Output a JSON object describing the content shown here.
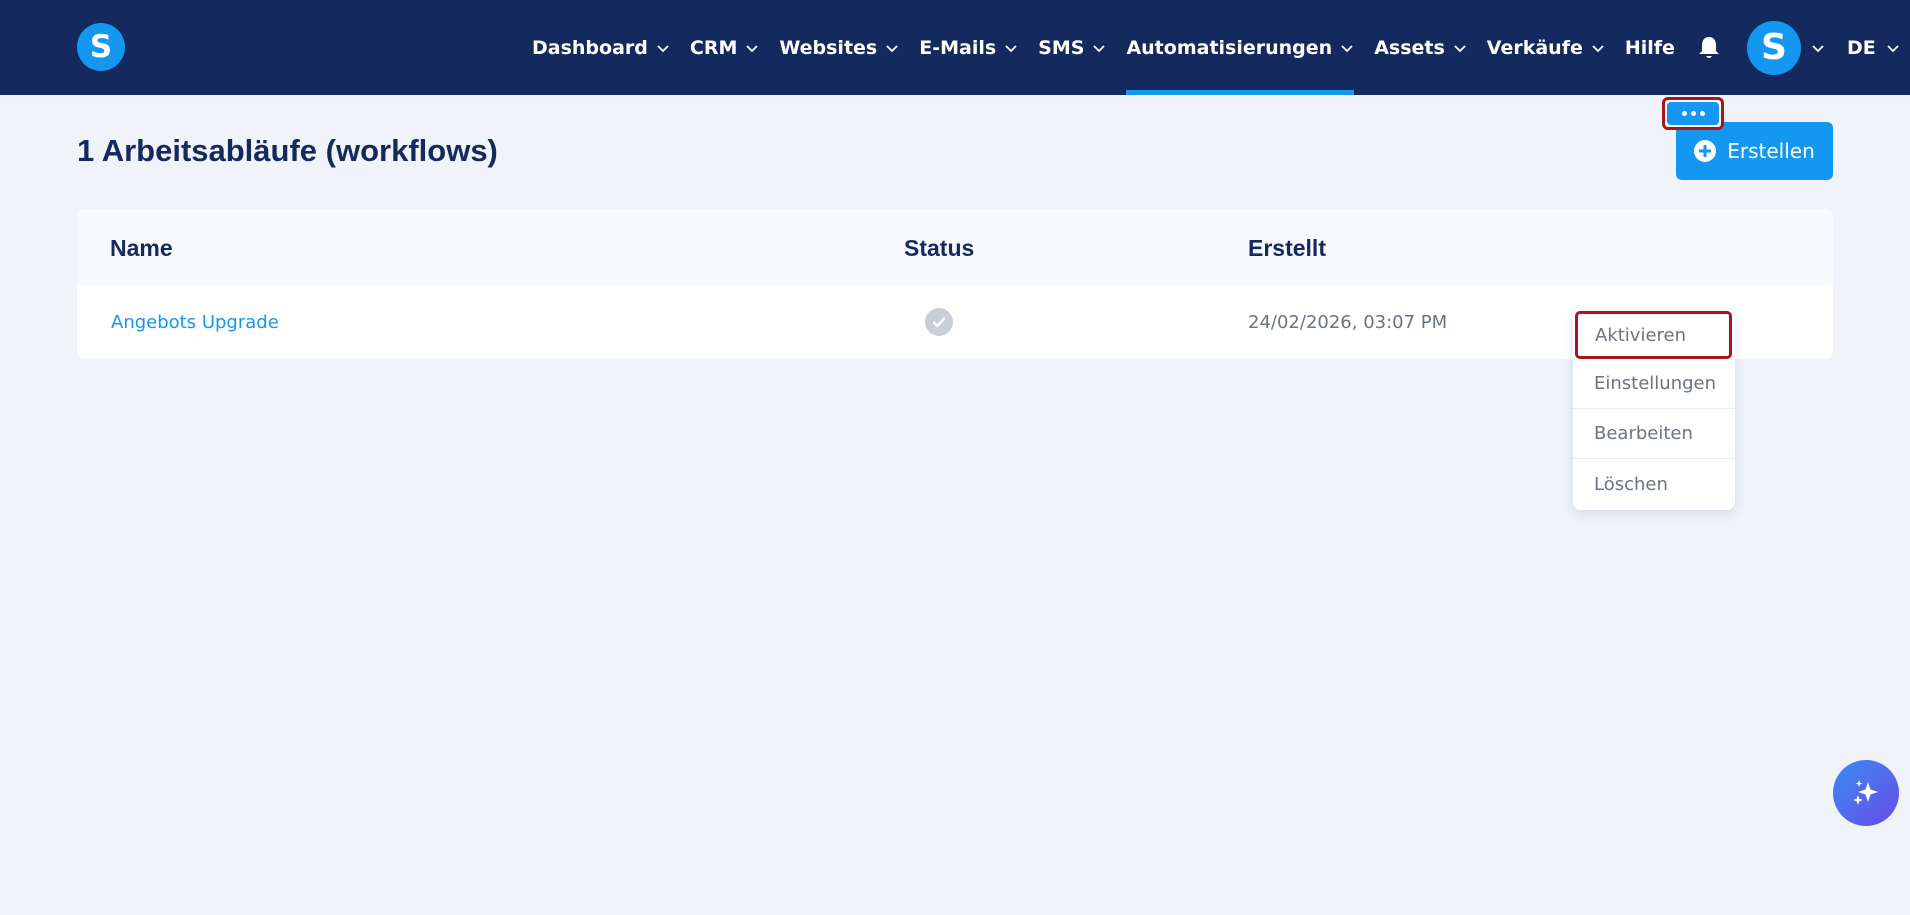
{
  "brand": {
    "logo_letter": "S"
  },
  "nav": {
    "items": [
      {
        "label": "Dashboard"
      },
      {
        "label": "CRM"
      },
      {
        "label": "Websites"
      },
      {
        "label": "E-Mails"
      },
      {
        "label": "SMS"
      },
      {
        "label": "Automatisierungen",
        "active": true
      },
      {
        "label": "Assets"
      },
      {
        "label": "Verkäufe"
      }
    ],
    "help_label": "Hilfe",
    "avatar_letter": "S",
    "language": "DE"
  },
  "page": {
    "title": "1 Arbeitsabläufe (workflows)",
    "create_label": "Erstellen"
  },
  "table": {
    "columns": {
      "name": "Name",
      "status": "Status",
      "created": "Erstellt"
    },
    "rows": [
      {
        "name": "Angebots Upgrade",
        "status": "check-circle-icon",
        "created": "24/02/2026, 03:07 PM"
      }
    ]
  },
  "menu": {
    "items": [
      {
        "label": "Aktivieren"
      },
      {
        "label": "Einstellungen"
      },
      {
        "label": "Bearbeiten"
      },
      {
        "label": "Löschen"
      }
    ]
  },
  "colors": {
    "nav_bg": "#142a5e",
    "accent": "#1497f0",
    "page_bg": "#f0f3f9",
    "highlight_border": "#a8151b"
  }
}
